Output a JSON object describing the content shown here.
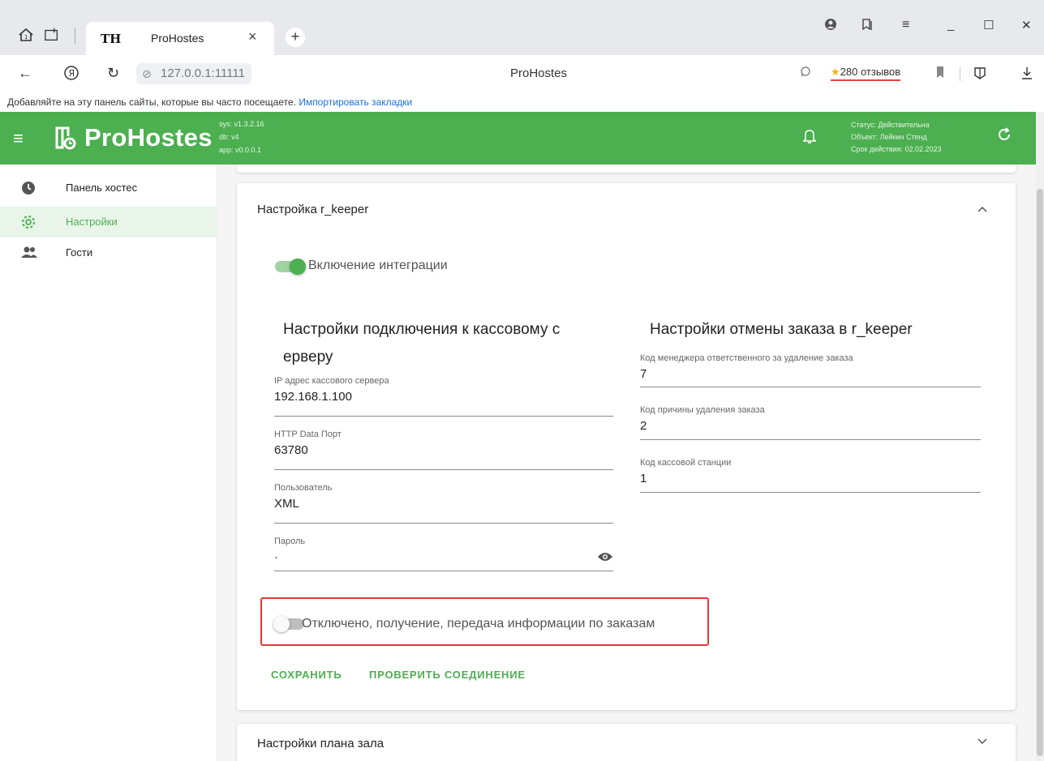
{
  "browser": {
    "tab_title": "ProHostes",
    "tab_favicon": "TH",
    "tab_close": "×",
    "new_tab": "+",
    "url": "127.0.0.1:11111",
    "page_title": "ProHostes",
    "reviews": "280 отзывов",
    "reviews_star": "★",
    "window_controls": {
      "minimize": "_",
      "maximize": "☐",
      "close": "✕"
    },
    "bookmarks_text": "Добавляйте на эту панель сайты, которые вы часто посещаете.",
    "bookmarks_link": "Импортировать закладки"
  },
  "appbar": {
    "brand": "ProHostes",
    "versions": [
      "sys: v1.3.2.16",
      "db: v4",
      "app: v0.0.0.1"
    ],
    "status": [
      "Статус: Действительна",
      "Объект: Лейкин Стенд",
      "Срок действия: 02.02.2023"
    ]
  },
  "sidebar": {
    "items": [
      {
        "label": "Панель хостес",
        "icon": "clock-icon",
        "active": false
      },
      {
        "label": "Настройки",
        "icon": "gear-icon",
        "active": true
      },
      {
        "label": "Гости",
        "icon": "guests-icon",
        "active": false
      }
    ]
  },
  "card": {
    "title": "Настройка r_keeper",
    "integration_label": "Включение интеграции",
    "integration_on": true,
    "connection": {
      "title_line1": "Настройки подключения к кассовому с",
      "title_line2": "ерверу",
      "fields": [
        {
          "label": "IP адрес кассового сервера",
          "value": "192.168.1.100"
        },
        {
          "label": "HTTP Data Порт",
          "value": "63780"
        },
        {
          "label": "Пользователь",
          "value": "XML"
        },
        {
          "label": "Пароль",
          "value": "·"
        }
      ]
    },
    "cancel": {
      "title": "Настройки отмены заказа в r_keeper",
      "fields": [
        {
          "label": "Код менеджера ответственного за удаление заказа",
          "value": "7"
        },
        {
          "label": "Код причины удаления заказа",
          "value": "2"
        },
        {
          "label": "Код кассовой станции",
          "value": "1"
        }
      ]
    },
    "orders_label": "Отключено, получение, передача информации по заказам",
    "orders_on": false,
    "save_button": "СОХРАНИТЬ",
    "check_button": "ПРОВЕРИТЬ СОЕДИНЕНИЕ"
  },
  "card2": {
    "title": "Настройки плана зала"
  },
  "colors": {
    "accent": "#4caf50",
    "highlight": "#e53935",
    "link": "#1a6fd8"
  }
}
